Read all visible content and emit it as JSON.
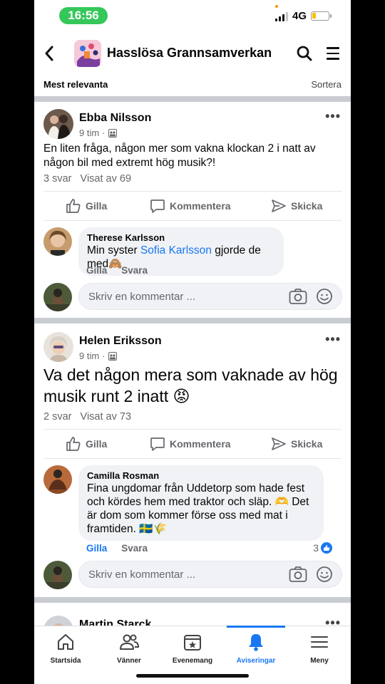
{
  "status": {
    "time": "16:56",
    "network": "4G"
  },
  "header": {
    "title": "Hasslösa Grannsamverkan"
  },
  "sortbar": {
    "left": "Mest relevanta",
    "right": "Sortera"
  },
  "posts": [
    {
      "author": "Ebba Nilsson",
      "time": "9 tim",
      "text": "En liten fråga, någon mer som vakna klockan 2 i natt av någon bil med extremt hög musik?!",
      "replies": "3 svar",
      "views": "Visat av 69",
      "actions": {
        "like": "Gilla",
        "comment": "Kommentera",
        "share": "Skicka"
      },
      "comment": {
        "name": "Therese Karlsson",
        "text_before": "Min syster ",
        "mention": "Sofia Karlsson",
        "text_after": " gjorde de med🙈",
        "like": "Gilla",
        "reply": "Svara"
      },
      "write_placeholder": "Skriv en kommentar ..."
    },
    {
      "author": "Helen Eriksson",
      "time": "9 tim",
      "text": "Va det någon mera som vaknade av hög musik runt 2 inatt 😡",
      "replies": "2 svar",
      "views": "Visat av 73",
      "actions": {
        "like": "Gilla",
        "comment": "Kommentera",
        "share": "Skicka"
      },
      "comment": {
        "name": "Camilla Rosman",
        "text": "Fina ungdomar från Uddetorp som hade fest och kördes hem med traktor och släp. 🫶 Det är dom som kommer förse oss med mat i framtiden. 🇸🇪🌾",
        "like": "Gilla",
        "reply": "Svara",
        "like_count": "3"
      },
      "write_placeholder": "Skriv en kommentar ..."
    },
    {
      "author": "Martin Starck"
    }
  ],
  "tabs": [
    {
      "label": "Startsida",
      "icon": "home-icon"
    },
    {
      "label": "Vänner",
      "icon": "friends-icon"
    },
    {
      "label": "Evenemang",
      "icon": "calendar-star-icon"
    },
    {
      "label": "Aviseringar",
      "icon": "bell-icon",
      "active": true
    },
    {
      "label": "Meny",
      "icon": "hamburger-icon"
    }
  ],
  "colors": {
    "accent": "#1877f2",
    "status_pill": "#35c759"
  }
}
